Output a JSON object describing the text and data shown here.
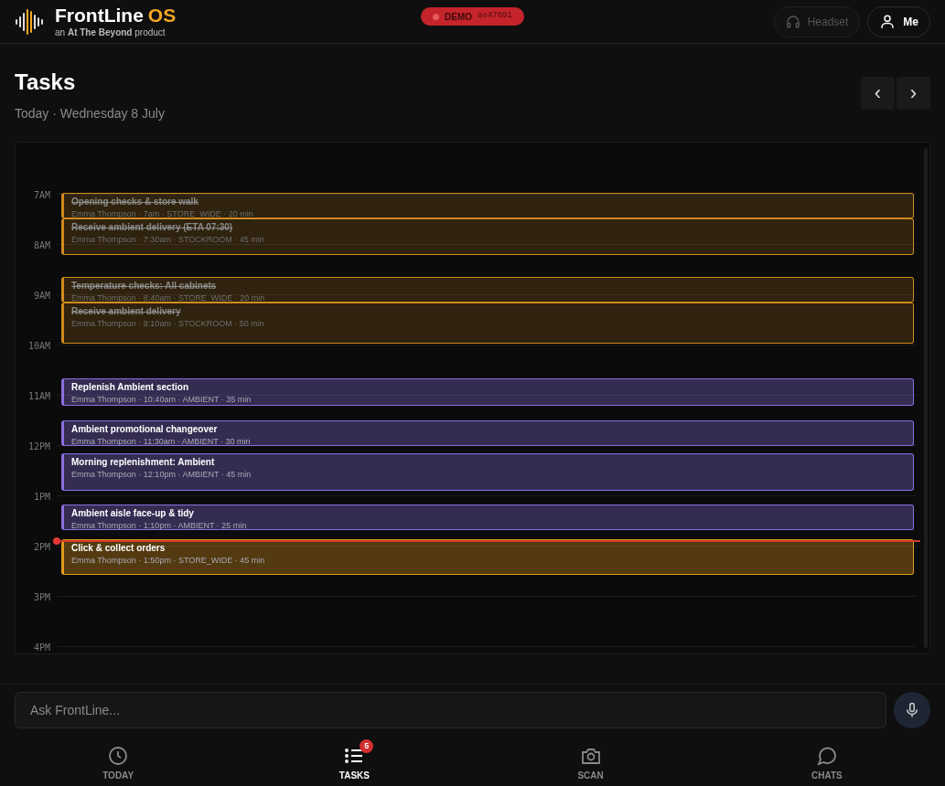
{
  "header": {
    "brand": "FrontLine",
    "brand_accent": "OS",
    "tagline": "an **At The Beyond** product",
    "demo_badge": {
      "label": "DEMO",
      "code": "ae47091"
    },
    "headset_button": {
      "label": "Headset",
      "disabled": true
    },
    "profile_button": {
      "label": "Me"
    }
  },
  "page": {
    "title": "Tasks",
    "subtitle": "Today · Wednesday 8 July",
    "nav": [
      "‹",
      "›"
    ]
  },
  "calendar": {
    "hours": [
      "7AM",
      "8AM",
      "9AM",
      "10AM",
      "11AM",
      "12PM",
      "1PM",
      "2PM",
      "3PM",
      "4PM"
    ],
    "events": [
      {
        "title": "Opening checks & store walk",
        "details": "Emma Thompson · 7am · STORE_WIDE · 20 min",
        "done": true,
        "color": "#d08a1e"
      },
      {
        "title": "Receive ambient delivery (ETA 07:30)",
        "details": "Emma Thompson · 7:30am · STOCKROOM · 45 min",
        "done": true,
        "color": "#d08a1e"
      },
      {
        "title": "Temperature checks: All cabinets",
        "details": "Emma Thompson · 8:40am · STORE_WIDE · 20 min",
        "done": true,
        "color": "#d08a1e"
      },
      {
        "title": "Receive ambient delivery",
        "details": "Emma Thompson · 9:10am · STOCKROOM · 50 min",
        "done": true,
        "color": "#d08a1e"
      },
      {
        "title": "Replenish Ambient section",
        "details": "Emma Thompson · 10:40am · AMBIENT · 35 min",
        "done": false,
        "color": "#8b6ee0"
      },
      {
        "title": "Ambient promotional changeover",
        "details": "Emma Thompson · 11:30am · AMBIENT · 30 min",
        "done": false,
        "color": "#8b6ee0"
      },
      {
        "title": "Morning replenishment: Ambient",
        "details": "Emma Thompson · 12:10pm · AMBIENT · 45 min",
        "done": false,
        "color": "#8b6ee0"
      },
      {
        "title": "Ambient aisle face-up & tidy",
        "details": "Emma Thompson · 1:10pm · AMBIENT · 25 min",
        "done": false,
        "color": "#8b6ee0"
      },
      {
        "title": "Click & collect orders",
        "details": "Emma Thompson · 1:50pm · STORE_WIDE · 45 min",
        "done": false,
        "color": "#e39a1e"
      }
    ]
  },
  "ask": {
    "placeholder": "Ask FrontLine..."
  },
  "tabs": [
    {
      "kind": "clock",
      "label": "TODAY",
      "selected": false
    },
    {
      "kind": "list",
      "label": "TASKS",
      "selected": true,
      "badge": "5"
    },
    {
      "kind": "camera",
      "label": "SCAN",
      "selected": false
    },
    {
      "kind": "chat",
      "label": "CHATS",
      "selected": false
    }
  ]
}
